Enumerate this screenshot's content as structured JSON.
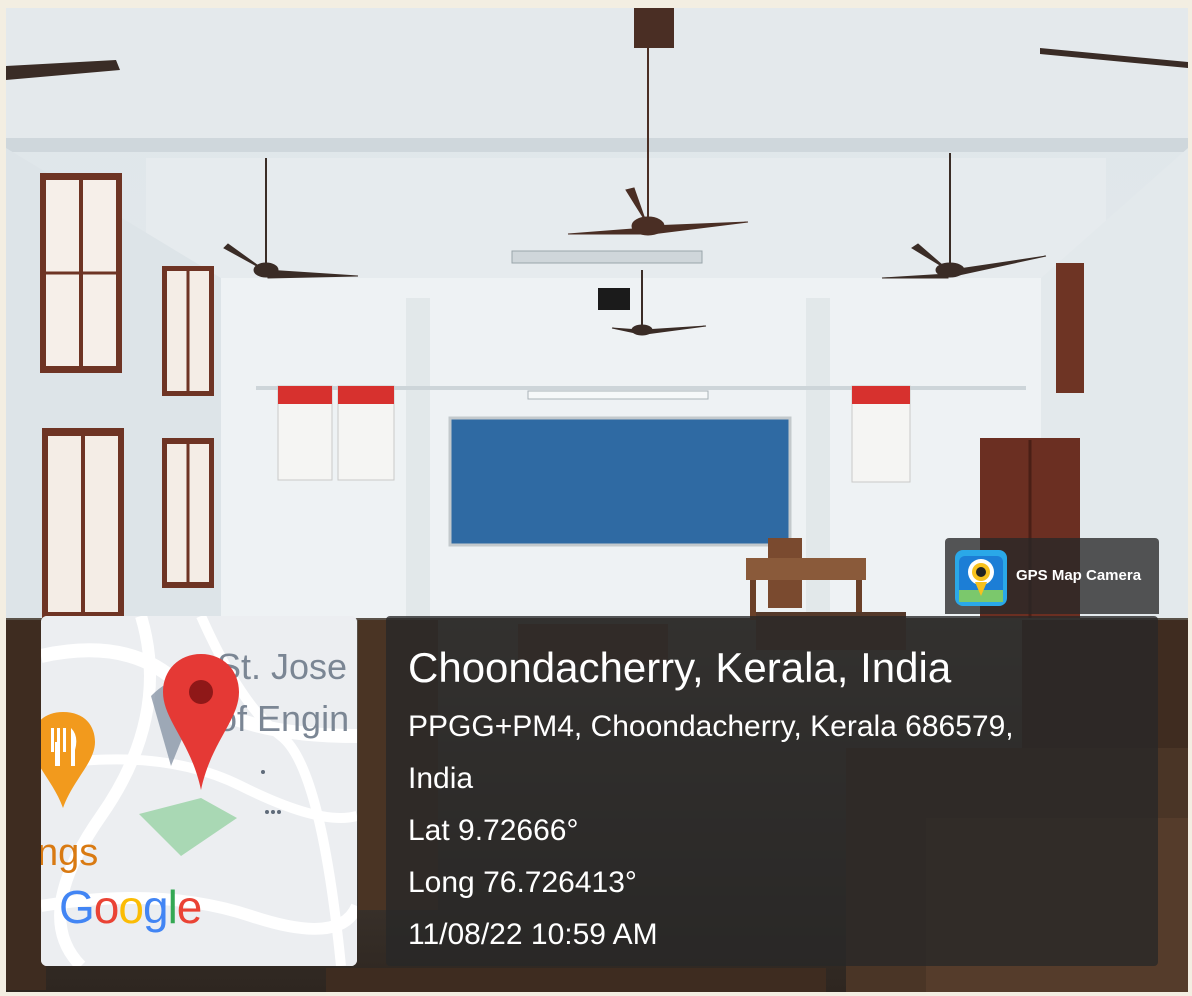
{
  "map": {
    "place_line_1": "St. Jose",
    "place_line_2": "of Engin",
    "poi_label": "ngs",
    "logo_text": "Google",
    "logo_letters": [
      "G",
      "o",
      "o",
      "g",
      "l",
      "e"
    ],
    "logo_colors": [
      "#4285F4",
      "#EA4335",
      "#FBBC05",
      "#4285F4",
      "#34A853",
      "#EA4335"
    ],
    "pin_color": "#E53935",
    "poi_color": "#F29A1D"
  },
  "app": {
    "name": "GPS Map Camera",
    "icon": "gps-map-camera-icon"
  },
  "location": {
    "title": "Choondacherry, Kerala, India",
    "address_line_1": "PPGG+PM4, Choondacherry, Kerala 686579,",
    "address_line_2": "India",
    "latitude": "Lat 9.72666°",
    "longitude": "Long 76.726413°",
    "timestamp": "11/08/22 10:59 AM"
  },
  "scene": {
    "description_icon": "classroom-photo",
    "board_color": "#2f6aa3",
    "wall_color": "#e9eef1",
    "desk_color": "#4a3424"
  }
}
